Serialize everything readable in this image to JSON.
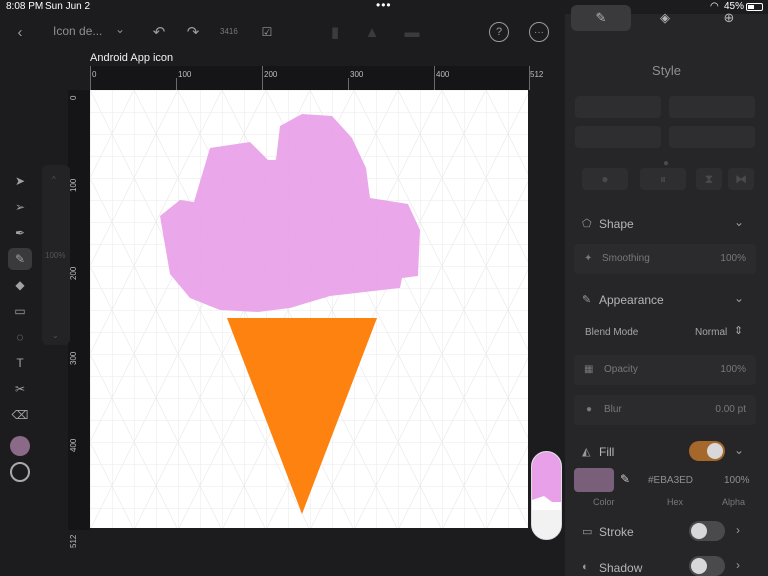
{
  "status_bar": {
    "time": "8:08 PM",
    "date": "Sun Jun 2",
    "battery": "45%"
  },
  "toolbar": {
    "document_title": "Icon de...",
    "value_hint": "3416"
  },
  "artboard": {
    "name": "Android App icon"
  },
  "rulers": {
    "top_ticks": [
      "0",
      "100",
      "200",
      "300",
      "400",
      "512"
    ],
    "left_ticks": [
      "0",
      "100",
      "200",
      "300",
      "400",
      "512"
    ]
  },
  "left_tools": {
    "zoom_label": "100%",
    "icons": [
      "pointer-icon",
      "direct-select-icon",
      "pen-icon",
      "brush-icon",
      "eraser-shape-icon",
      "rectangle-icon",
      "lasso-icon",
      "text-icon",
      "scissors-icon",
      "eraser-icon"
    ]
  },
  "panel": {
    "heading": "Style",
    "shape": {
      "title": "Shape",
      "smoothing_label": "Smoothing",
      "smoothing_value": "100%"
    },
    "appearance": {
      "title": "Appearance",
      "blend_mode_label": "Blend Mode",
      "blend_mode_value": "Normal",
      "opacity_label": "Opacity",
      "opacity_value": "100%",
      "blur_label": "Blur",
      "blur_value": "0.00 pt"
    },
    "fill": {
      "title": "Fill",
      "hex": "#EBA3ED",
      "alpha": "100%",
      "color_caption": "Color",
      "hex_caption": "Hex",
      "alpha_caption": "Alpha",
      "swatch_color": "#7a5f7a"
    },
    "stroke": {
      "title": "Stroke"
    },
    "shadow": {
      "title": "Shadow"
    }
  },
  "colors": {
    "ice_cream": "#e8a0e8",
    "cone": "#fd8210",
    "accent_toggle": "#a5682a"
  }
}
